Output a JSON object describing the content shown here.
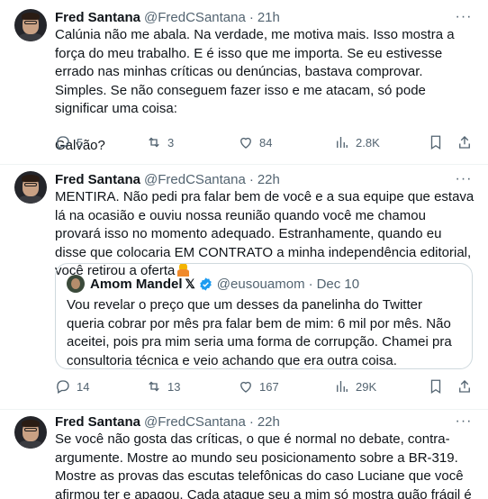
{
  "tweets": [
    {
      "author": {
        "name": "Fred Santana",
        "handle": "@FredCSantana",
        "time": "21h"
      },
      "text": "Calúnia não me abala. Na verdade, me motiva mais. Isso mostra a força do meu trabalho. E é isso que me importa. Se eu estivesse errado nas minhas críticas ou denúncias, bastava comprovar. Simples. Se não conseguem fazer isso e me atacam, só pode significar uma coisa:\n\nGalvão?",
      "stats": {
        "replies": "5",
        "retweets": "3",
        "likes": "84",
        "views": "2.8K"
      }
    },
    {
      "author": {
        "name": "Fred Santana",
        "handle": "@FredCSantana",
        "time": "22h"
      },
      "text": "MENTIRA. Não pedi pra falar bem de você e a sua equipe que estava lá na ocasião e ouviu nossa reunião quando você me chamou provará isso no momento adequado. Estranhamente, quando eu disse que colocaria EM CONTRATO a minha independência editorial, você retirou a oferta",
      "quote": {
        "name": "Amom Mandel",
        "handle": "@eusouamom",
        "time": "Dec 10",
        "text": "Vou revelar o preço que um desses da panelinha do Twitter queria cobrar por mês pra falar bem de mim: 6 mil por mês. Não aceitei, pois pra mim seria uma forma de corrupção. Chamei pra consultoria técnica e veio achando que era outra coisa."
      },
      "stats": {
        "replies": "14",
        "retweets": "13",
        "likes": "167",
        "views": "29K"
      }
    },
    {
      "author": {
        "name": "Fred Santana",
        "handle": "@FredCSantana",
        "time": "22h"
      },
      "text": "Se você não gosta das críticas, o que é normal no debate, contra-argumente. Mostre ao mundo seu posicionamento sobre a BR-319. Mostre as provas das escutas telefônicas do caso Luciane que você afirmou ter e apagou. Cada ataque seu a mim só mostra quão frágil é sua argumentação"
    }
  ],
  "colors": {
    "text": "#0f1419",
    "muted": "#536471",
    "border": "#cfd9de",
    "verified": "#1d9bf0"
  },
  "icons": [
    "more-icon",
    "reply-icon",
    "retweet-icon",
    "like-icon",
    "views-icon",
    "bookmark-icon",
    "share-icon",
    "verified-badge-icon",
    "x-affiliate-icon",
    "person-emoji-icon"
  ]
}
